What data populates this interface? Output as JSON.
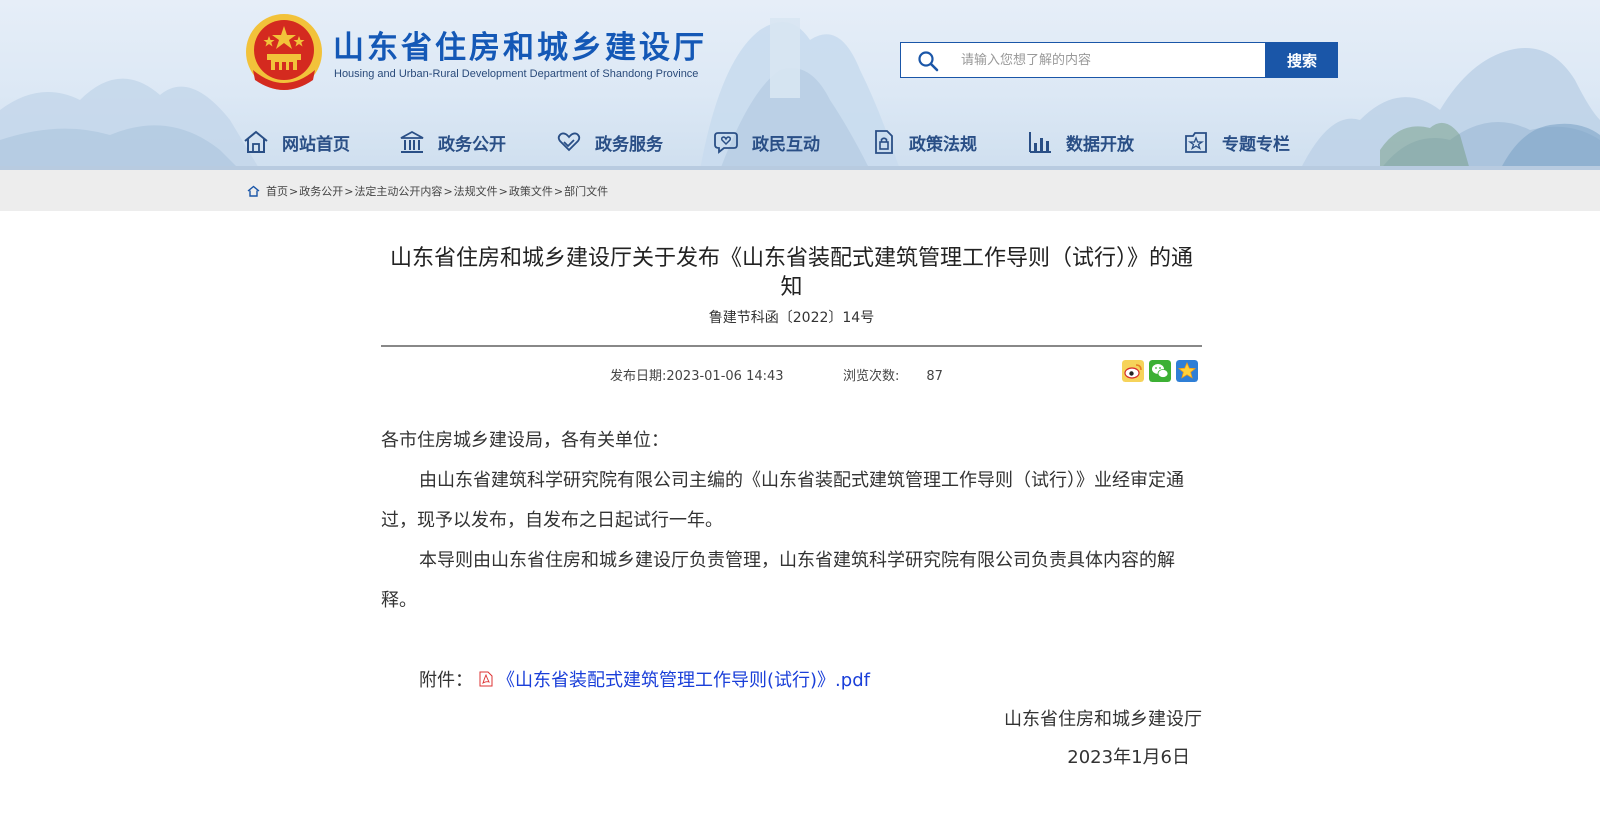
{
  "header": {
    "site_title": "山东省住房和城乡建设厅",
    "site_subtitle": "Housing and Urban-Rural Development Department of Shandong Province",
    "search_placeholder": "请输入您想了解的内容",
    "search_button": "搜索",
    "colors": {
      "brand_blue": "#1458b6",
      "nav_text": "#2a4f86",
      "emblem_red": "#d42a1f",
      "emblem_gold": "#f2c23a"
    }
  },
  "nav": {
    "items": [
      {
        "label": "网站首页",
        "icon": "home-icon"
      },
      {
        "label": "政务公开",
        "icon": "government-building-icon"
      },
      {
        "label": "政务服务",
        "icon": "handshake-heart-icon"
      },
      {
        "label": "政民互动",
        "icon": "chat-heart-icon"
      },
      {
        "label": "政策法规",
        "icon": "document-lock-icon"
      },
      {
        "label": "数据开放",
        "icon": "bar-chart-icon"
      },
      {
        "label": "专题专栏",
        "icon": "star-folder-icon"
      }
    ]
  },
  "breadcrumb": {
    "items": [
      "首页",
      "政务公开",
      "法定主动公开内容",
      "法规文件",
      "政策文件",
      "部门文件"
    ],
    "separator": ">"
  },
  "article": {
    "title": "山东省住房和城乡建设厅关于发布《山东省装配式建筑管理工作导则（试行）》的通知",
    "doc_number": "鲁建节科函〔2022〕14号",
    "publish_label": "发布日期:",
    "publish_date": "2023-01-06 14:43",
    "views_label": "浏览次数:",
    "views": "87",
    "share_icons": [
      "weibo-icon",
      "wechat-icon",
      "favorite-star-icon"
    ],
    "salutation": "各市住房城乡建设局，各有关单位：",
    "paragraphs": [
      "由山东省建筑科学研究院有限公司主编的《山东省装配式建筑管理工作导则（试行）》业经审定通过，现予以发布，自发布之日起试行一年。",
      "本导则由山东省住房和城乡建设厅负责管理，山东省建筑科学研究院有限公司负责具体内容的解释。"
    ],
    "attachment_label": "附件：",
    "attachment_name": "《山东省装配式建筑管理工作导则(试行)》.pdf",
    "signer": "山东省住房和城乡建设厅",
    "sign_date": "2023年1月6日"
  }
}
